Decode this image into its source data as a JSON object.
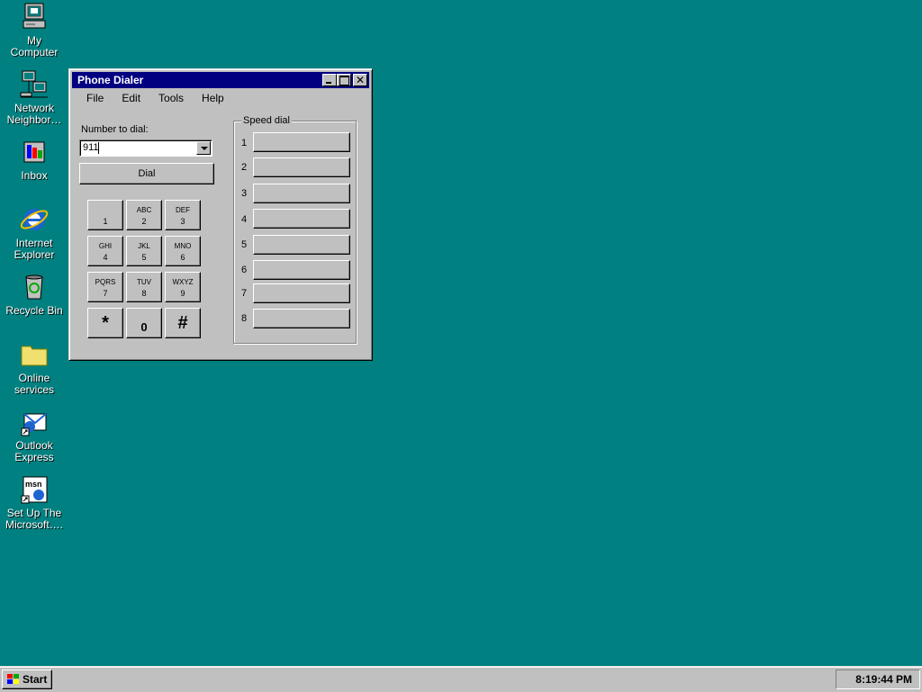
{
  "desktop": {
    "icons": [
      {
        "name": "my-computer",
        "label": "My\nComputer"
      },
      {
        "name": "network-neighborhood",
        "label": "Network\nNeighbor…"
      },
      {
        "name": "inbox",
        "label": "Inbox"
      },
      {
        "name": "internet-explorer",
        "label": "Internet\nExplorer"
      },
      {
        "name": "recycle-bin",
        "label": "Recycle Bin"
      },
      {
        "name": "online-services",
        "label": "Online\nservices"
      },
      {
        "name": "outlook-express",
        "label": "Outlook\nExpress"
      },
      {
        "name": "set-up-msn",
        "label": "Set Up The\nMicrosoft…."
      }
    ]
  },
  "window": {
    "title": "Phone Dialer",
    "menu": [
      "File",
      "Edit",
      "Tools",
      "Help"
    ],
    "number_label": "Number to dial:",
    "number_value": "911",
    "dial_label": "Dial",
    "keypad": [
      {
        "letters": "",
        "digit": "1"
      },
      {
        "letters": "ABC",
        "digit": "2"
      },
      {
        "letters": "DEF",
        "digit": "3"
      },
      {
        "letters": "GHI",
        "digit": "4"
      },
      {
        "letters": "JKL",
        "digit": "5"
      },
      {
        "letters": "MNO",
        "digit": "6"
      },
      {
        "letters": "PQRS",
        "digit": "7"
      },
      {
        "letters": "TUV",
        "digit": "8"
      },
      {
        "letters": "WXYZ",
        "digit": "9"
      },
      {
        "symbol": "*"
      },
      {
        "symbol": "0"
      },
      {
        "symbol": "#"
      }
    ],
    "speed_dial_label": "Speed dial",
    "speed_dial": [
      "1",
      "2",
      "3",
      "4",
      "5",
      "6",
      "7",
      "8"
    ]
  },
  "taskbar": {
    "start_label": "Start",
    "clock": "8:19:44 PM"
  },
  "colors": {
    "desktop": "#008080",
    "titlebar": "#000080",
    "face": "#c0c0c0"
  }
}
